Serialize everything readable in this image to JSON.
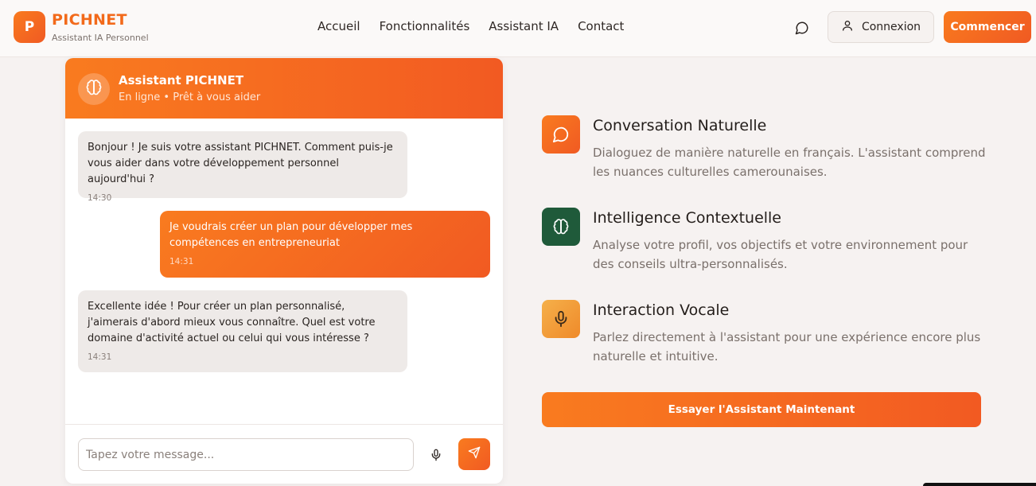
{
  "brand": {
    "logo_letter": "P",
    "name": "PICHNET",
    "tagline": "Assistant IA Personnel"
  },
  "nav": {
    "items": [
      "Accueil",
      "Fonctionnalités",
      "Assistant IA",
      "Contact"
    ]
  },
  "header": {
    "login_label": "Connexion",
    "start_label": "Commencer"
  },
  "chat": {
    "title": "Assistant PICHNET",
    "status": "En ligne • Prêt à vous aider",
    "messages": [
      {
        "sender": "bot",
        "text": "Bonjour ! Je suis votre assistant PICHNET. Comment puis-je vous aider dans votre développement personnel aujourd'hui ?",
        "time": "14:30"
      },
      {
        "sender": "user",
        "text": "Je voudrais créer un plan pour développer mes compétences en entrepreneuriat",
        "time": "14:31"
      },
      {
        "sender": "bot",
        "text": "Excellente idée ! Pour créer un plan personnalisé, j'aimerais d'abord mieux vous connaître. Quel est votre domaine d'activité actuel ou celui qui vous intéresse ?",
        "time": "14:31"
      }
    ],
    "input_placeholder": "Tapez votre message..."
  },
  "features": [
    {
      "icon": "chat-bubble-icon",
      "title": "Conversation Naturelle",
      "description": "Dialoguez de manière naturelle en français. L'assistant comprend les nuances culturelles camerounaises.",
      "color": "#f26a1b"
    },
    {
      "icon": "brain-icon",
      "title": "Intelligence Contextuelle",
      "description": "Analyse votre profil, vos objectifs et votre environnement pour des conseils ultra-personnalisés.",
      "color": "#1f5a3a"
    },
    {
      "icon": "microphone-icon",
      "title": "Interaction Vocale",
      "description": "Parlez directement à l'assistant pour une expérience encore plus naturelle et intuitive.",
      "color": "#f2a23a"
    }
  ],
  "cta": {
    "label": "Essayer l'Assistant Maintenant"
  },
  "colors": {
    "accent": "#f26a1b",
    "accent_dark": "#f05a23",
    "green": "#1f5a3a",
    "amber": "#f2a23a",
    "background": "#f6f2f1"
  }
}
